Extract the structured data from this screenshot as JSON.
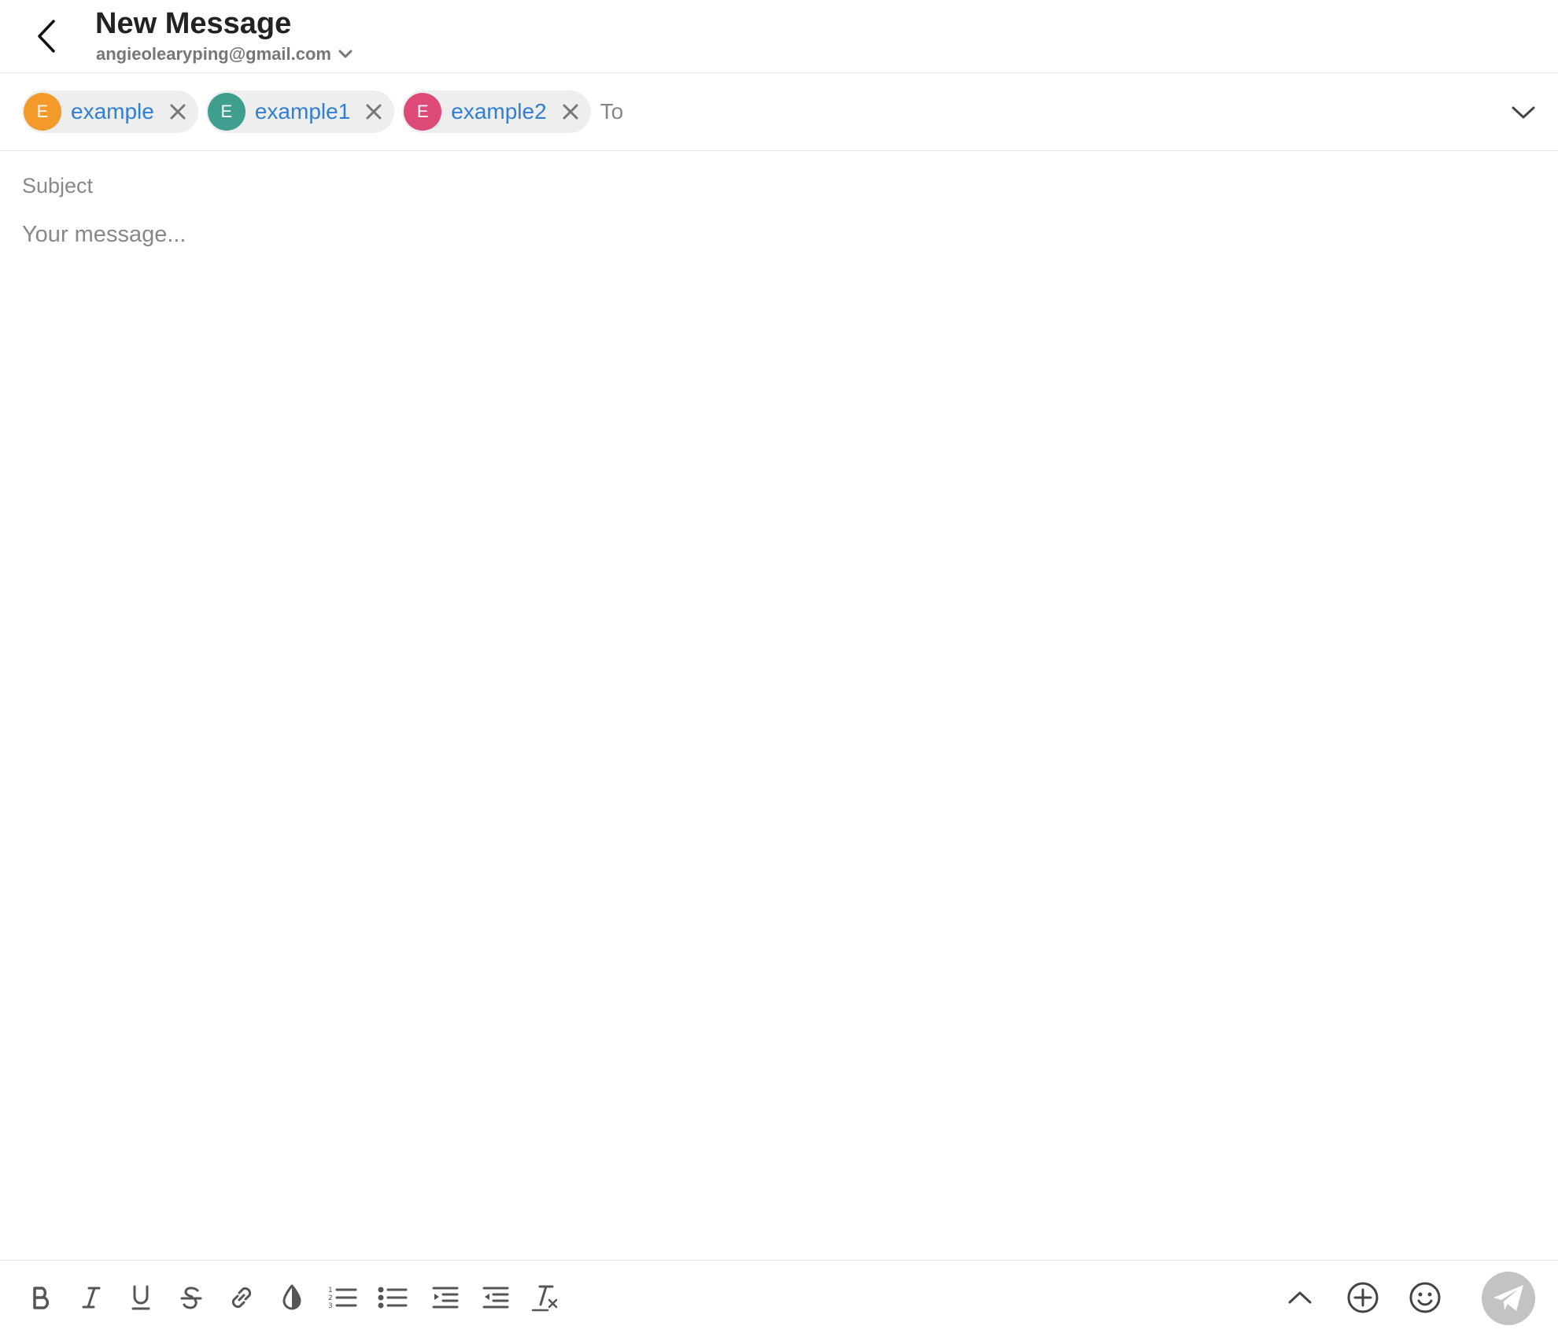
{
  "header": {
    "title": "New Message",
    "account_email": "angieolearyping@gmail.com",
    "back_icon": "chevron-left-icon",
    "account_icon": "chevron-down-icon"
  },
  "recipients": {
    "chips": [
      {
        "initial": "E",
        "name": "example",
        "color": "#f39a2b"
      },
      {
        "initial": "E",
        "name": "example1",
        "color": "#3f9e8f"
      },
      {
        "initial": "E",
        "name": "example2",
        "color": "#dd4a78"
      }
    ],
    "to_placeholder": "To",
    "expand_icon": "chevron-down-icon"
  },
  "compose": {
    "subject_placeholder": "Subject",
    "message_placeholder": "Your message..."
  },
  "toolbar": {
    "format_icons": [
      "bold-icon",
      "italic-icon",
      "underline-icon",
      "strikethrough-icon",
      "link-icon",
      "text-color-icon",
      "numbered-list-icon",
      "bullet-list-icon",
      "indent-icon",
      "outdent-icon",
      "clear-format-icon"
    ],
    "right_icons": [
      "chevron-up-icon",
      "add-circle-icon",
      "emoji-icon",
      "send-icon"
    ]
  },
  "colors": {
    "accent_link": "#2f7fd6",
    "send_disabled": "#c3c3c3"
  }
}
